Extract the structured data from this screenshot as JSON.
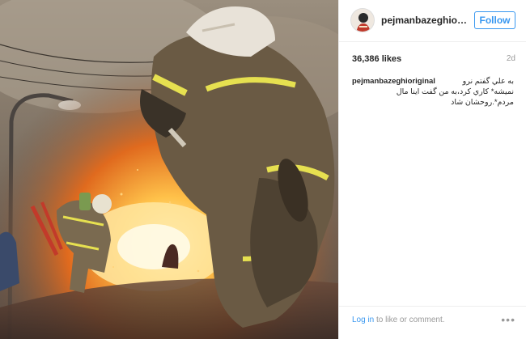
{
  "post": {
    "artwork_alt": "Firefighters running into fire",
    "header": {
      "username": "pejmanbazeghiorigi...",
      "follow_label": "Follow",
      "avatar_icon": "user-avatar-icon"
    },
    "likes": "36,386 likes",
    "time_ago": "2d",
    "caption": {
      "username": "pejmanbazeghioriginal",
      "text": "به علي گفتم نرو نمیشه* کاري کرد،به من گفت اینا مال مردم*.روحشان شاد"
    },
    "footer": {
      "login_link": "Log in",
      "login_suffix": " to like or comment.",
      "more_icon": "more-options-icon",
      "more_glyph": "•••"
    }
  },
  "colors": {
    "link_blue": "#3897f0",
    "muted": "#999999",
    "text": "#262626"
  }
}
